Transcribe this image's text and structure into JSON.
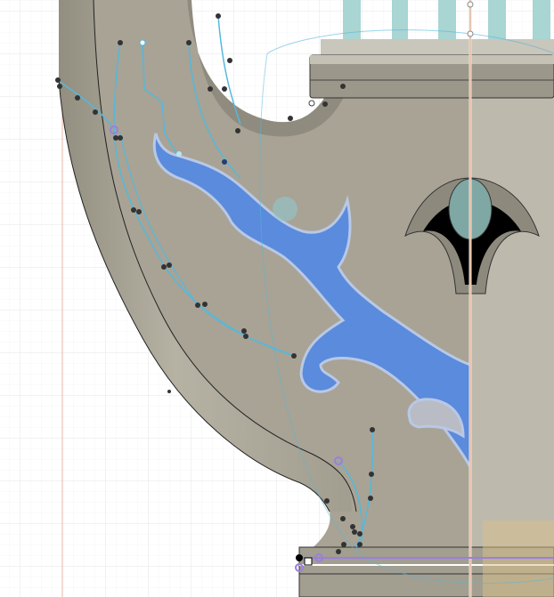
{
  "viewport": {
    "tool": "sketch-canvas",
    "colors": {
      "background": "#ffffff",
      "grid": "#e4e4e4",
      "axis_red": "#e0a898",
      "body": "#a9a496",
      "body_light": "#c2beb2",
      "decal_blue": "#5b8ddb",
      "sketch_cyan": "#55b8dc",
      "constraint_purple": "#9b7fe0",
      "column_teal": "#a8d4d2",
      "highlight_tan": "#d9c08a"
    }
  }
}
